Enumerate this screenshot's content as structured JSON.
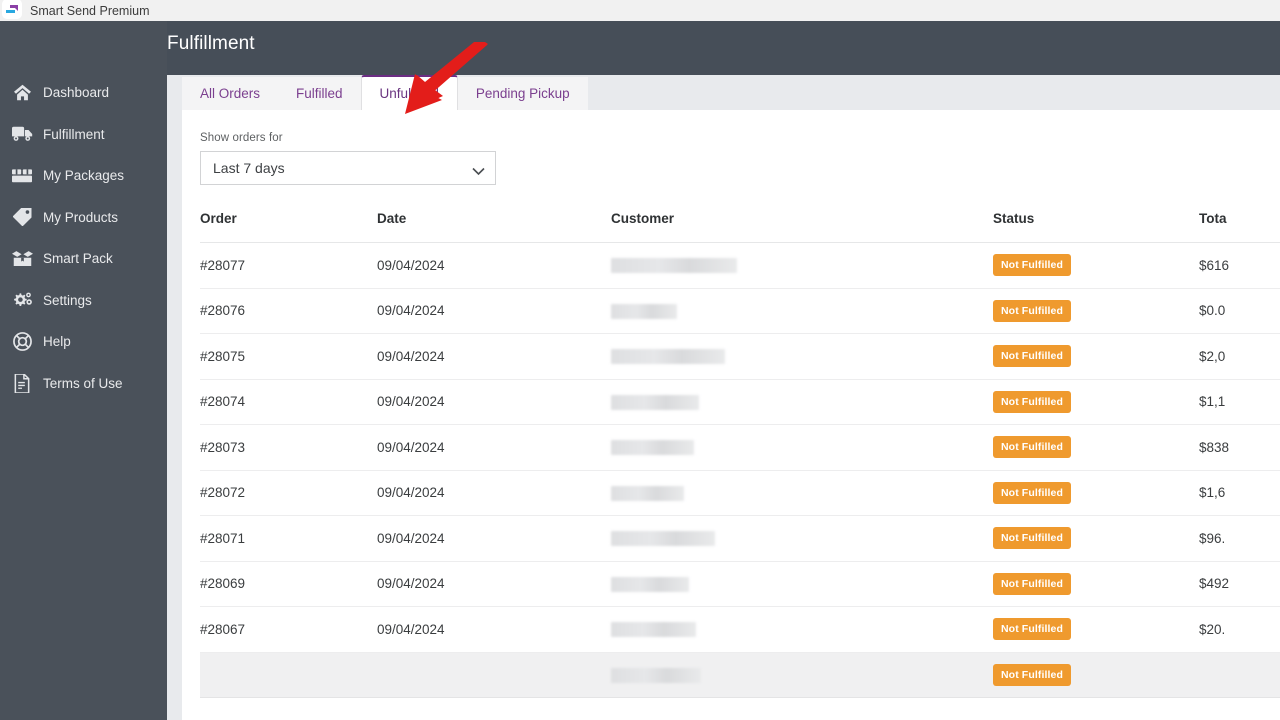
{
  "browser": {
    "app_title": "Smart Send Premium",
    "logo_icon": "smart-send-logo-icon"
  },
  "header": {
    "title": "Fulfillment"
  },
  "sidebar": {
    "items": [
      {
        "label": "Dashboard",
        "icon": "home-icon"
      },
      {
        "label": "Fulfillment",
        "icon": "truck-icon"
      },
      {
        "label": "My Packages",
        "icon": "boxes-icon"
      },
      {
        "label": "My Products",
        "icon": "tag-icon"
      },
      {
        "label": "Smart Pack",
        "icon": "open-box-icon"
      },
      {
        "label": "Settings",
        "icon": "gears-icon"
      },
      {
        "label": "Help",
        "icon": "lifebuoy-icon"
      },
      {
        "label": "Terms of Use",
        "icon": "document-icon"
      }
    ]
  },
  "tabs": [
    {
      "label": "All Orders",
      "active": false
    },
    {
      "label": "Fulfilled",
      "active": false
    },
    {
      "label": "Unfulfilled",
      "active": true
    },
    {
      "label": "Pending Pickup",
      "active": false
    }
  ],
  "filter": {
    "label": "Show orders for",
    "selected": "Last 7 days",
    "chevron_icon": "chevron-down-icon"
  },
  "table": {
    "columns": [
      "Order",
      "Date",
      "Customer",
      "Status",
      "Tota"
    ],
    "rows": [
      {
        "order": "#28077",
        "date": "09/04/2024",
        "customer_width": 126,
        "status": "Not Fulfilled",
        "total": "$616"
      },
      {
        "order": "#28076",
        "date": "09/04/2024",
        "customer_width": 66,
        "status": "Not Fulfilled",
        "total": "$0.0"
      },
      {
        "order": "#28075",
        "date": "09/04/2024",
        "customer_width": 114,
        "status": "Not Fulfilled",
        "total": "$2,0"
      },
      {
        "order": "#28074",
        "date": "09/04/2024",
        "customer_width": 88,
        "status": "Not Fulfilled",
        "total": "$1,1"
      },
      {
        "order": "#28073",
        "date": "09/04/2024",
        "customer_width": 83,
        "status": "Not Fulfilled",
        "total": "$838"
      },
      {
        "order": "#28072",
        "date": "09/04/2024",
        "customer_width": 73,
        "status": "Not Fulfilled",
        "total": "$1,6"
      },
      {
        "order": "#28071",
        "date": "09/04/2024",
        "customer_width": 104,
        "status": "Not Fulfilled",
        "total": "$96."
      },
      {
        "order": "#28069",
        "date": "09/04/2024",
        "customer_width": 78,
        "status": "Not Fulfilled",
        "total": "$492"
      },
      {
        "order": "#28067",
        "date": "09/04/2024",
        "customer_width": 85,
        "status": "Not Fulfilled",
        "total": "$20."
      },
      {
        "order": "",
        "date": "",
        "customer_width": 90,
        "status": "Not Fulfilled",
        "total": "",
        "hover": true
      }
    ]
  },
  "annotation": {
    "arrow_icon": "red-arrow-icon",
    "arrow_color": "#e31d1a",
    "points_to": "Unfulfilled"
  },
  "colors": {
    "sidebar_bg": "#4a515a",
    "header_bg": "#464e58",
    "content_bg": "#e8eaed",
    "tab_accent": "#6c2d84",
    "tab_text": "#7b3f8f",
    "badge_bg": "#ef9a2e"
  }
}
